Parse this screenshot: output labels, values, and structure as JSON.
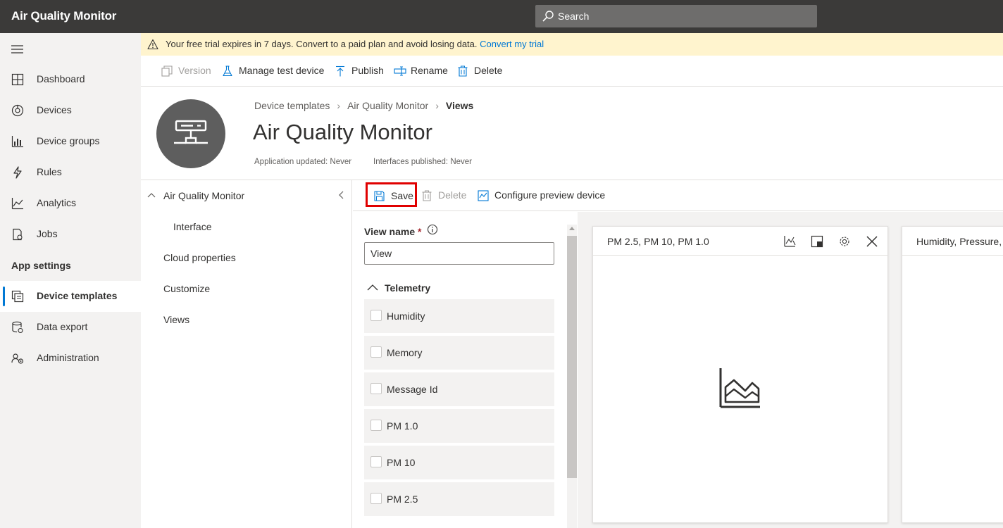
{
  "app": {
    "title": "Air Quality Monitor"
  },
  "search": {
    "placeholder": "Search"
  },
  "nav": {
    "items": [
      {
        "label": "Dashboard",
        "icon": "dashboard-icon"
      },
      {
        "label": "Devices",
        "icon": "devices-icon"
      },
      {
        "label": "Device groups",
        "icon": "device-groups-icon"
      },
      {
        "label": "Rules",
        "icon": "rules-icon"
      },
      {
        "label": "Analytics",
        "icon": "analytics-icon"
      },
      {
        "label": "Jobs",
        "icon": "jobs-icon"
      }
    ],
    "section_label": "App settings",
    "settings_items": [
      {
        "label": "Device templates",
        "icon": "device-templates-icon",
        "selected": true
      },
      {
        "label": "Data export",
        "icon": "data-export-icon"
      },
      {
        "label": "Administration",
        "icon": "administration-icon"
      }
    ]
  },
  "banner": {
    "text": "Your free trial expires in 7 days. Convert to a paid plan and avoid losing data.",
    "link": "Convert my trial"
  },
  "commands": {
    "version": "Version",
    "manage_test_device": "Manage test device",
    "publish": "Publish",
    "rename": "Rename",
    "delete": "Delete"
  },
  "header": {
    "breadcrumb": [
      "Device templates",
      "Air Quality Monitor",
      "Views"
    ],
    "title": "Air Quality Monitor",
    "app_updated": "Application updated: Never",
    "interfaces_published": "Interfaces published: Never"
  },
  "tree": {
    "root": "Air Quality Monitor",
    "interface": "Interface",
    "cloud_properties": "Cloud properties",
    "customize": "Customize",
    "views": "Views"
  },
  "view_toolbar": {
    "save": "Save",
    "delete": "Delete",
    "configure_preview": "Configure preview device"
  },
  "config": {
    "view_name_label": "View name",
    "required_mark": "*",
    "view_name_value": "View",
    "telemetry_header": "Telemetry",
    "telemetry": [
      "Humidity",
      "Memory",
      "Message Id",
      "PM 1.0",
      "PM 10",
      "PM 2.5"
    ]
  },
  "tiles": [
    {
      "title": "PM 2.5, PM 10, PM 1.0"
    },
    {
      "title": "Humidity, Pressure, Temperature"
    }
  ],
  "colors": {
    "accent": "#0078d4",
    "topbar": "#3b3a39",
    "banner": "#fff4ce",
    "highlight": "#e00000"
  }
}
